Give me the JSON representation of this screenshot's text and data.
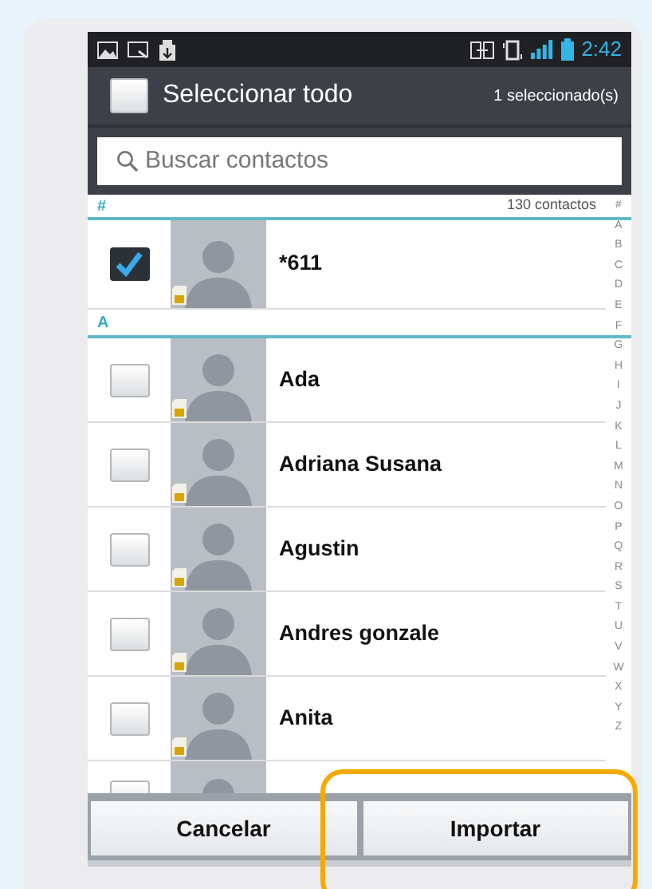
{
  "status_bar": {
    "time": "2:42"
  },
  "header": {
    "select_all": {
      "label": "Seleccionar todo",
      "checked": false
    },
    "selected_count": "1 seleccionado(s)"
  },
  "search": {
    "placeholder": "Buscar contactos"
  },
  "sections": [
    {
      "label": "#",
      "count": "130 contactos",
      "contacts": [
        {
          "name": "*611",
          "checked": true
        }
      ]
    },
    {
      "label": "A",
      "contacts": [
        {
          "name": "Ada",
          "checked": false
        },
        {
          "name": "Adriana Susana",
          "checked": false
        },
        {
          "name": "Agustin",
          "checked": false
        },
        {
          "name": "Andres gonzale",
          "checked": false
        },
        {
          "name": "Anita",
          "checked": false
        }
      ]
    }
  ],
  "partial_row": {
    "checked": false
  },
  "index": [
    "#",
    "A",
    "B",
    "C",
    "D",
    "E",
    "F",
    "G",
    "H",
    "I",
    "J",
    "K",
    "L",
    "M",
    "N",
    "O",
    "P",
    "Q",
    "R",
    "S",
    "T",
    "U",
    "V",
    "W",
    "X",
    "Y",
    "Z"
  ],
  "buttons": [
    {
      "label": "Cancelar"
    },
    {
      "label": "Importar"
    }
  ]
}
